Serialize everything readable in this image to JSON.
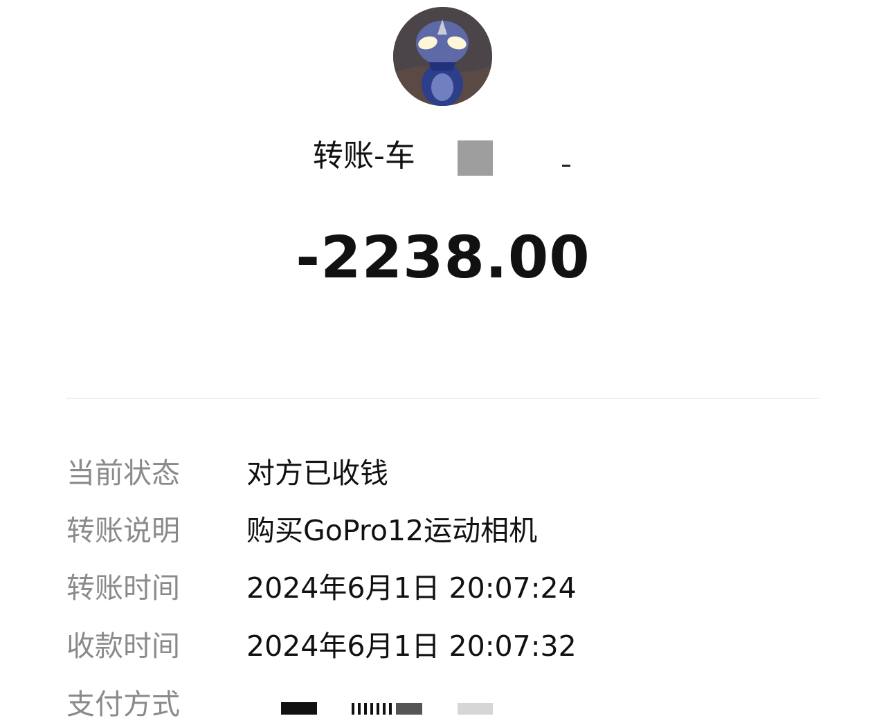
{
  "payee": {
    "title": "转账-车",
    "avatar_icon": "avatar-icon"
  },
  "transaction": {
    "amount": "-2238.00"
  },
  "details": [
    {
      "label": "当前状态",
      "value": "对方已收钱"
    },
    {
      "label": "转账说明",
      "value": "购买GoPro12运动相机"
    },
    {
      "label": "转账时间",
      "value": "2024年6月1日 20:07:24"
    },
    {
      "label": "收款时间",
      "value": "2024年6月1日 20:07:32"
    },
    {
      "label": "支付方式",
      "value": ""
    }
  ],
  "colors": {
    "label": "#8a8a8a",
    "value": "#111111",
    "divider": "#dcdcdc",
    "redaction_gray": "#9e9e9e"
  }
}
